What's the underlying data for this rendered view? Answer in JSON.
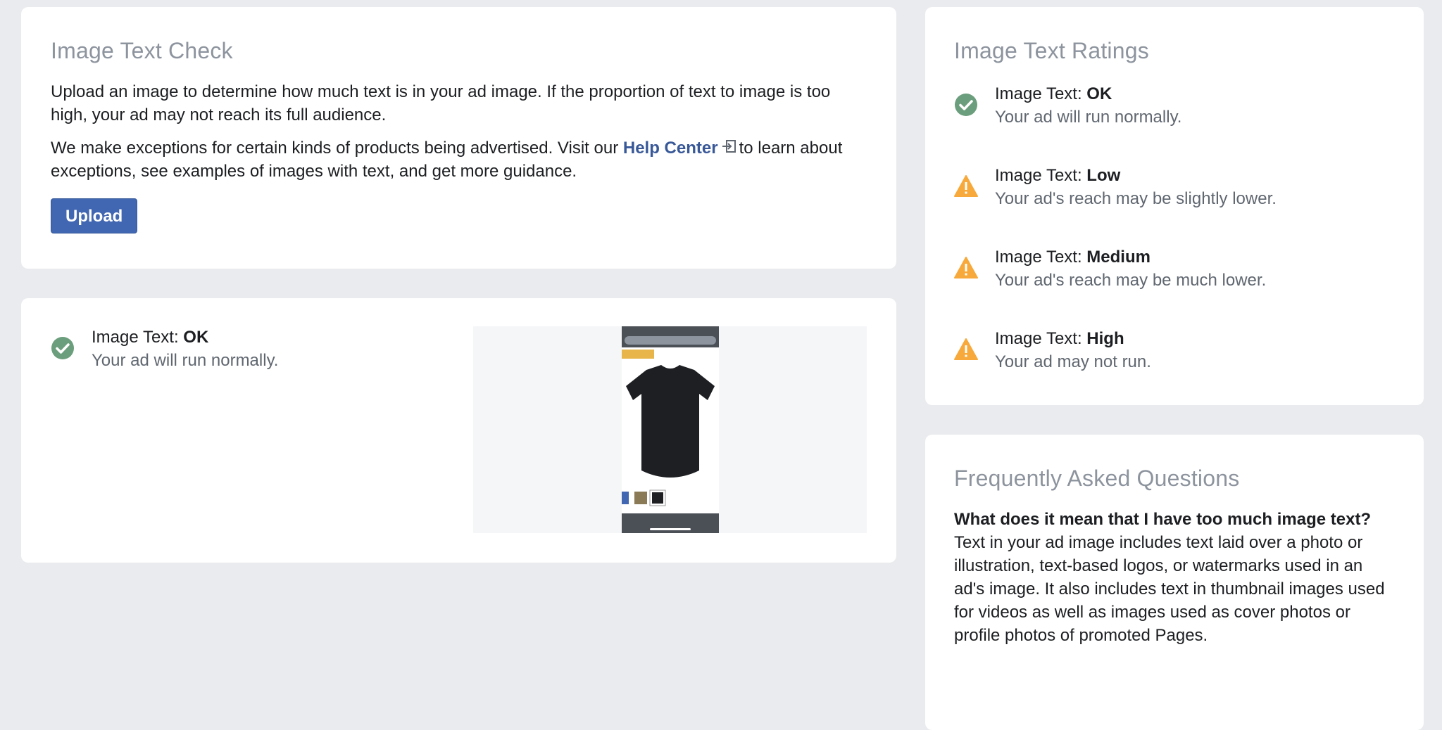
{
  "check": {
    "title": "Image Text Check",
    "para1": "Upload an image to determine how much text is in your ad image. If the proportion of text to image is too high, your ad may not reach its full audience.",
    "para2_before": "We make exceptions for certain kinds of products being advertised. Visit our",
    "para2_link": "Help Center",
    "para2_after": "to learn about exceptions, see examples of images with text, and get more guidance.",
    "upload_label": "Upload"
  },
  "result": {
    "prefix": "Image Text:",
    "level": "OK",
    "desc": "Your ad will run normally.",
    "icon": "check-circle-icon"
  },
  "ratings": {
    "title": "Image Text Ratings",
    "items": [
      {
        "prefix": "Image Text:",
        "level": "OK",
        "desc": "Your ad will run normally.",
        "icon": "check-circle-icon"
      },
      {
        "prefix": "Image Text:",
        "level": "Low",
        "desc": "Your ad's reach may be slightly lower.",
        "icon": "warning-icon"
      },
      {
        "prefix": "Image Text:",
        "level": "Medium",
        "desc": "Your ad's reach may be much lower.",
        "icon": "warning-icon"
      },
      {
        "prefix": "Image Text:",
        "level": "High",
        "desc": "Your ad may not run.",
        "icon": "warning-icon"
      }
    ]
  },
  "faq": {
    "title": "Frequently Asked Questions",
    "q1": "What does it mean that I have too much image text?",
    "a1": "Text in your ad image includes text laid over a photo or illustration, text-based logos, or watermarks used in an ad's image. It also includes text in thumbnail images used for videos as well as images used as cover photos or profile photos of promoted Pages."
  },
  "colors": {
    "ok_green": "#6b9e7c",
    "warning_orange": "#f7a93b",
    "link_blue": "#385898",
    "button_blue": "#4267b2"
  }
}
